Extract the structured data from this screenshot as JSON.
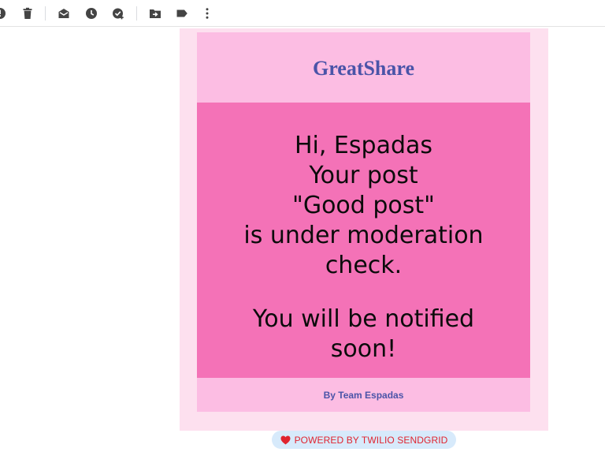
{
  "toolbar": {
    "icons": [
      "report-spam-icon",
      "delete-icon",
      "mark-unread-icon",
      "snooze-icon",
      "add-task-icon",
      "move-to-icon",
      "label-icon",
      "more-options-icon"
    ]
  },
  "email": {
    "brand": "GreatShare",
    "message_lines": [
      "Hi, Espadas",
      "Your post",
      "\"Good post\"",
      "is under moderation",
      "check."
    ],
    "notice_lines": [
      "You will be notified",
      "soon!"
    ],
    "signature": "By Team Espadas"
  },
  "badge": {
    "text": "POWERED BY TWILIO SENDGRID"
  },
  "colors": {
    "outer": "#fde0ef",
    "header": "#fcbde3",
    "body": "#f472b7",
    "brand_text": "#4a54a8",
    "badge_text": "#e0242f",
    "badge_bg": "#d7eafb"
  }
}
